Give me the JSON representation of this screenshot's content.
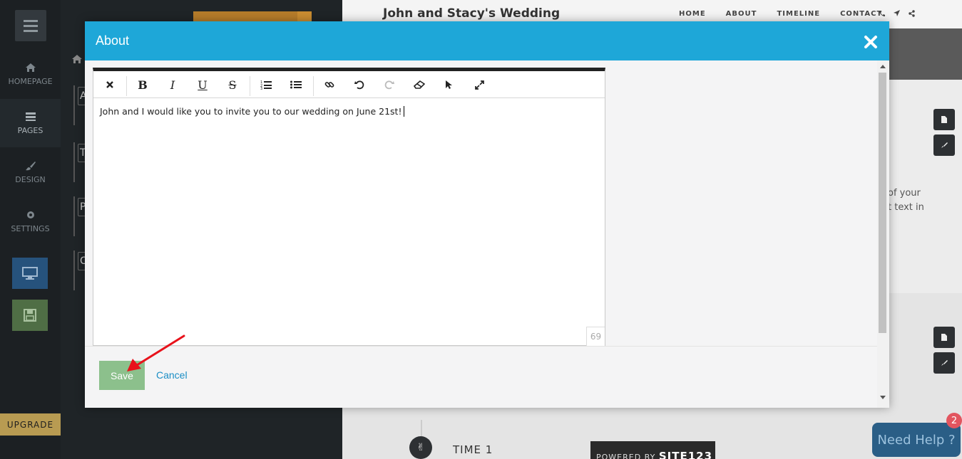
{
  "sidebar": {
    "items": [
      {
        "label": "HOMEPAGE",
        "icon": "home-icon"
      },
      {
        "label": "PAGES",
        "icon": "pages-icon"
      },
      {
        "label": "DESIGN",
        "icon": "brush-icon"
      },
      {
        "label": "SETTINGS",
        "icon": "gear-icon"
      }
    ],
    "upgrade_label": "UPGRADE"
  },
  "panel": {
    "row_letters": [
      "A",
      "T",
      "P",
      "C"
    ]
  },
  "site": {
    "title": "John and Stacy's Wedding",
    "nav": [
      "HOME",
      "ABOUT",
      "TIMELINE",
      "CONTACT"
    ],
    "snippet_line1": "of your",
    "snippet_line2": "t text in",
    "timeline_label": "TIME 1",
    "powered_prefix": "POWERED BY",
    "powered_brand": "SITE123"
  },
  "modal": {
    "title": "About",
    "content_text": "John and I would like you to invite you to our wedding on June 21st!",
    "char_count": "69",
    "save_label": "Save",
    "cancel_label": "Cancel",
    "toolbar": {
      "bold": "B",
      "italic": "I",
      "underline": "U",
      "strike": "S"
    }
  },
  "help": {
    "label": "Need Help ?",
    "badge": "2"
  },
  "colors": {
    "modal_header": "#1ea7d8",
    "save_button": "#8cc08c",
    "cancel_link": "#1b8ec5",
    "upgrade": "#b89b52",
    "help_button": "#2a5e86",
    "annotation_arrow": "#e8121b"
  }
}
